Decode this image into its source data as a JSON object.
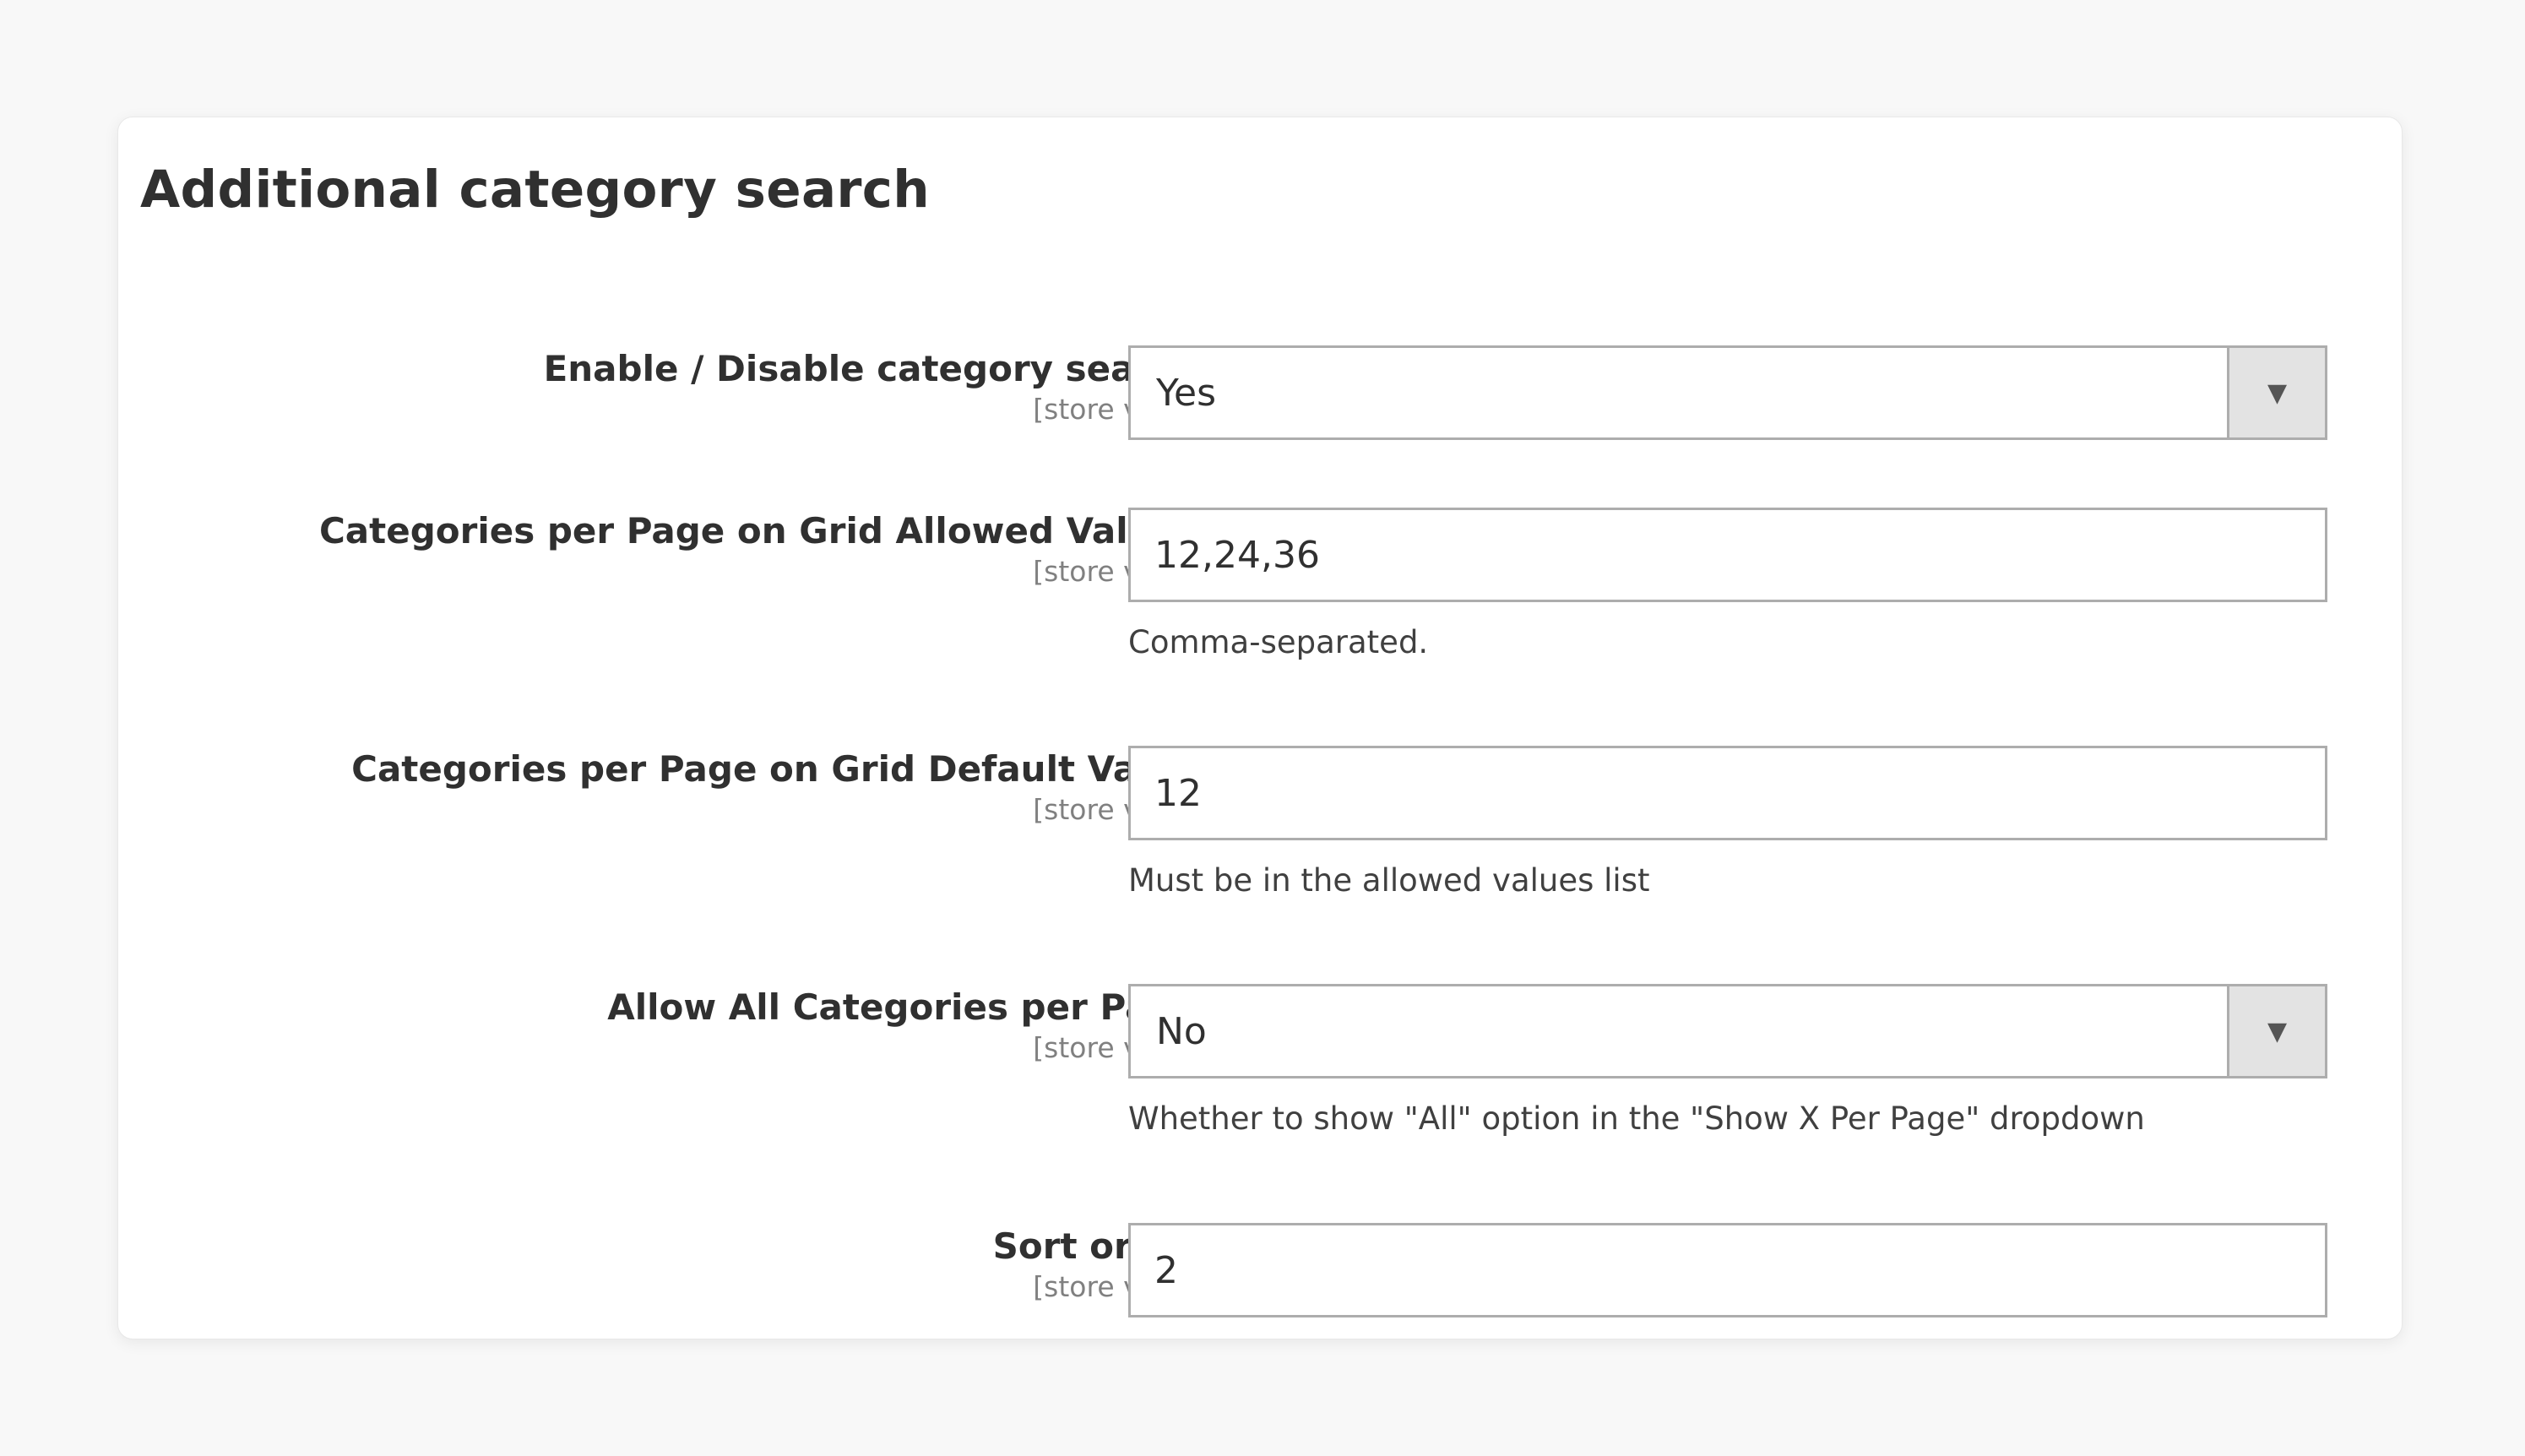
{
  "section": {
    "title": "Additional category search"
  },
  "fields": [
    {
      "label": "Enable / Disable category search",
      "scope": "[store view]",
      "type": "select",
      "value": "Yes",
      "arrow_icon": "chevron-down-icon"
    },
    {
      "label": "Categories per Page on Grid Allowed Values",
      "scope": "[store view]",
      "type": "text",
      "value": "12,24,36",
      "note": "Comma-separated."
    },
    {
      "label": "Categories per Page on Grid Default Value",
      "scope": "[store view]",
      "type": "text",
      "value": "12",
      "note": "Must be in the allowed values list"
    },
    {
      "label": "Allow All Categories per Page",
      "scope": "[store view]",
      "type": "select",
      "value": "No",
      "arrow_icon": "chevron-down-icon",
      "note": "Whether to show \"All\" option in the \"Show X Per Page\" dropdown"
    },
    {
      "label": "Sort order",
      "scope": "[store view]",
      "type": "text",
      "value": "2"
    }
  ]
}
